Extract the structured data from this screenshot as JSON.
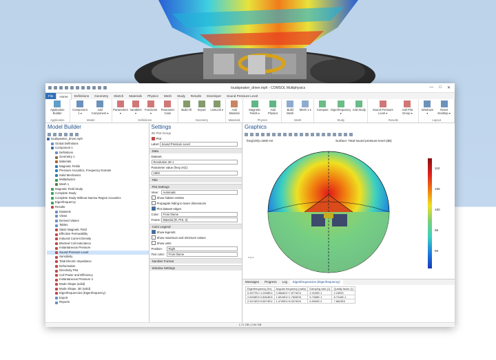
{
  "window": {
    "title": "loudspeaker_driver.mph - COMSOL Multiphysics",
    "min": "—",
    "max": "□",
    "close": "✕"
  },
  "menu": [
    "File",
    "Home",
    "Definitions",
    "Geometry",
    "Sketch",
    "Materials",
    "Physics",
    "Mesh",
    "Study",
    "Results",
    "Developer",
    "Sound Pressure Level"
  ],
  "ribbon": {
    "groups": [
      {
        "label": "Application",
        "buttons": [
          "Application Builder"
        ]
      },
      {
        "label": "Model",
        "buttons": [
          "Component 1 ▾",
          "Add Component ▾"
        ]
      },
      {
        "label": "Definitions",
        "buttons": [
          "Parameters ▾",
          "Variables ▾",
          "Functions ▾",
          "Parameter Case"
        ]
      },
      {
        "label": "Geometry",
        "buttons": [
          "Build All",
          "Import",
          "LiveLink ▾"
        ]
      },
      {
        "label": "Materials",
        "buttons": [
          "Add Material"
        ]
      },
      {
        "label": "Physics",
        "buttons": [
          "Magnetic Fields ▾",
          "Add Physics"
        ]
      },
      {
        "label": "Mesh",
        "buttons": [
          "Build Mesh",
          "Mesh 1 ▾"
        ]
      },
      {
        "label": "Study",
        "buttons": [
          "Compute",
          "Eigenfrequency ▾",
          "Add Study"
        ]
      },
      {
        "label": "Results",
        "buttons": [
          "Sound Pressure Level ▾",
          "Add Plot Group ▾"
        ]
      },
      {
        "label": "Layout",
        "buttons": [
          "Windows ▾",
          "Reset Desktop ▾"
        ]
      }
    ]
  },
  "model_builder": {
    "title": "Model Builder",
    "tree": [
      {
        "label": "loudspeaker_driver.mph",
        "lvl": 0,
        "color": "#3a6ea5"
      },
      {
        "label": "Global Definitions",
        "lvl": 1,
        "color": "#6a8fbf"
      },
      {
        "label": "Component 1",
        "lvl": 1,
        "color": "#3a6ea5"
      },
      {
        "label": "Definitions",
        "lvl": 2,
        "color": "#6a8fbf"
      },
      {
        "label": "Geometry 1",
        "lvl": 2,
        "color": "#8a6a3a"
      },
      {
        "label": "Materials",
        "lvl": 2,
        "color": "#b55d2c"
      },
      {
        "label": "Magnetic Fields",
        "lvl": 2,
        "color": "#2c7eb5"
      },
      {
        "label": "Pressure Acoustics, Frequency Domain",
        "lvl": 2,
        "color": "#2c7eb5"
      },
      {
        "label": "Solid Mechanics",
        "lvl": 2,
        "color": "#2c7eb5"
      },
      {
        "label": "Multiphysics",
        "lvl": 2,
        "color": "#2c9e5c"
      },
      {
        "label": "Mesh 1",
        "lvl": 2,
        "color": "#5b7a3a"
      },
      {
        "label": "Magnetic Field Study",
        "lvl": 1,
        "color": "#3aa55d"
      },
      {
        "label": "Complete Study",
        "lvl": 1,
        "color": "#3aa55d"
      },
      {
        "label": "Complete Study Without Narrow Region Acoustics",
        "lvl": 1,
        "color": "#3aa55d"
      },
      {
        "label": "Eigenfrequency",
        "lvl": 1,
        "color": "#3aa55d"
      },
      {
        "label": "Results",
        "lvl": 1,
        "color": "#c04a4a"
      },
      {
        "label": "Datasets",
        "lvl": 2,
        "color": "#6a8fbf"
      },
      {
        "label": "Views",
        "lvl": 2,
        "color": "#6a8fbf"
      },
      {
        "label": "Derived Values",
        "lvl": 2,
        "color": "#6a8fbf"
      },
      {
        "label": "Tables",
        "lvl": 2,
        "color": "#6a8fbf"
      },
      {
        "label": "Static Magnetic Field",
        "lvl": 2,
        "color": "#c04a4a"
      },
      {
        "label": "Effective Permeability",
        "lvl": 2,
        "color": "#c04a4a"
      },
      {
        "label": "Induced Current Density",
        "lvl": 2,
        "color": "#c04a4a"
      },
      {
        "label": "Blocked Coil Inductance",
        "lvl": 2,
        "color": "#c04a4a"
      },
      {
        "label": "Instantaneous Pressure",
        "lvl": 2,
        "color": "#c04a4a"
      },
      {
        "label": "Sound Pressure Level",
        "lvl": 2,
        "color": "#c04a4a",
        "sel": true
      },
      {
        "label": "Sensitivity",
        "lvl": 2,
        "color": "#c04a4a"
      },
      {
        "label": "Total Electric Impedance",
        "lvl": 2,
        "color": "#c04a4a"
      },
      {
        "label": "Deformation",
        "lvl": 2,
        "color": "#c04a4a"
      },
      {
        "label": "Directivity Plot",
        "lvl": 2,
        "color": "#c04a4a"
      },
      {
        "label": "Coil Power and Efficiency",
        "lvl": 2,
        "color": "#c04a4a"
      },
      {
        "label": "Instantaneous Pressure 2",
        "lvl": 2,
        "color": "#c04a4a"
      },
      {
        "label": "Mode Shape (solid)",
        "lvl": 2,
        "color": "#c04a4a"
      },
      {
        "label": "Mode Shape, 3D (solid)",
        "lvl": 2,
        "color": "#c04a4a"
      },
      {
        "label": "Eigenfrequencies (Eigenfrequency)",
        "lvl": 2,
        "color": "#c04a4a"
      },
      {
        "label": "Export",
        "lvl": 2,
        "color": "#6a8fbf"
      },
      {
        "label": "Reports",
        "lvl": 2,
        "color": "#6a8fbf"
      }
    ]
  },
  "settings": {
    "title": "Settings",
    "subtitle": "3D Plot Group",
    "plot_button": "Plot",
    "label_label": "Label:",
    "label_value": "Sound Pressure Level",
    "sec_data": "Data",
    "dataset_label": "Dataset:",
    "dataset_value": "Revolution 2D 1",
    "param_label": "Parameter value (freq (Hz)):",
    "param_value": "1800",
    "sec_title": "Title",
    "sec_plot": "Plot Settings",
    "view_label": "View:",
    "view_value": "Automatic",
    "chk_hidden": "Show hidden entities",
    "chk_propagate": "Propagate hiding to lower dimensions",
    "chk_edges": "Plot dataset edges",
    "color_label": "Color:",
    "color_value": "From theme",
    "frame_label": "Frame:",
    "frame_value": "Material  (R, PHI, Z)",
    "sec_legend": "Color Legend",
    "chk_legends": "Show legends",
    "chk_minmax": "Show maximum and minimum values",
    "chk_units": "Show units",
    "position_label": "Position:",
    "position_value": "Right",
    "textcolor_label": "Text color:",
    "textcolor_value": "From theme",
    "sec_number": "Number Format",
    "sec_window": "Window Settings"
  },
  "graphics": {
    "title": "Graphics",
    "freq": "freq(100)=1800 Hz",
    "surface_title": "Surface: Total sound pressure level (dB)",
    "legend_ticks": [
      "110",
      "105",
      "100",
      "95",
      "90"
    ],
    "axes": [
      "z",
      "y",
      "x"
    ]
  },
  "messages": {
    "tabs": [
      "Messages",
      "Progress",
      "Log",
      "Eigenfrequencies (Eigenfrequency)"
    ],
    "headers": [
      "Eigenfrequency (Hz)",
      "Angular frequency (rad/s)",
      "Damping ratio (1)",
      "Quality factor (1)"
    ],
    "rows": [
      [
        "5.3577E1+1.2998E1i",
        "3.3664E2+7.8774E1i",
        "2.3199E-1",
        "2.15593"
      ],
      [
        "2.6928E3+2.8064E2i",
        "1.6919E4+1.7633E3i",
        "5.7038E-1",
        "8.7016E-1"
      ],
      [
        "2.3474E3+9.6574E1i",
        "1.4749E4+6.0074E2i",
        "6.5000E-2",
        "7.6623E0"
      ]
    ]
  },
  "status": "1.71 GB | 2.04 GB"
}
